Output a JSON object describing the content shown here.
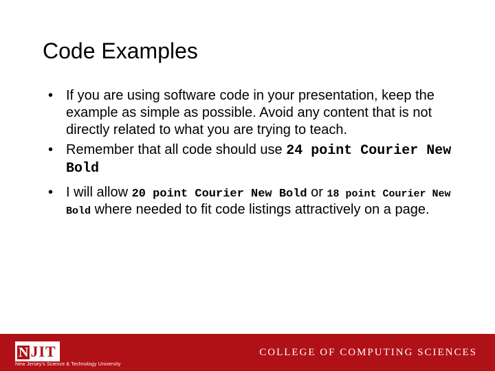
{
  "title": "Code Examples",
  "bullets": {
    "b1": "If you are using software code in your presentation, keep the example as simple as possible. Avoid any content that is not directly related to what you are trying to teach.",
    "b2_pre": "Remember that all code should use ",
    "b2_code": "24 point Courier New Bold",
    "b3_pre": "I will allow ",
    "b3_code1": "20 point Courier New Bold",
    "b3_mid": " or ",
    "b3_code2": "18 point Courier New Bold",
    "b3_post": " where needed to fit code listings attractively on a page."
  },
  "footer": {
    "logo_n": "N",
    "logo_rest": "JIT",
    "tagline": "New Jersey's Science & Technology University",
    "college": "COLLEGE OF COMPUTING SCIENCES"
  }
}
